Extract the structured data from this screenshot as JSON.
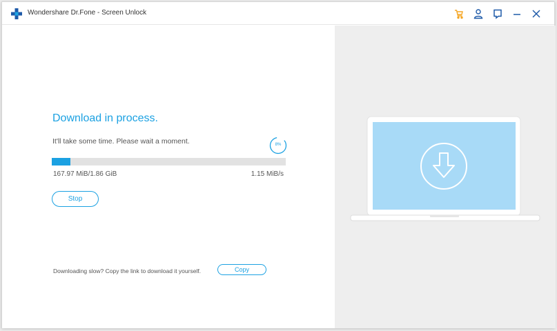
{
  "window": {
    "title": "Wondershare Dr.Fone - Screen Unlock",
    "icons": [
      "cart-icon",
      "account-icon",
      "feedback-icon",
      "minimize-icon",
      "close-icon"
    ]
  },
  "colors": {
    "accent": "#1ba1e2",
    "cart": "#f5a623",
    "right_panel_bg": "#eeeeee",
    "screen_bg": "#a8daf7"
  },
  "download": {
    "heading": "Download in process.",
    "subtext": "It'll take some time. Please wait a moment.",
    "percent_label": "8%",
    "progress": 0.08,
    "size": "167.97 MiB/1.86 GiB",
    "speed": "1.15 MiB/s",
    "stop_label": "Stop",
    "slow_text": "Downloading slow? Copy the link to download it yourself.",
    "copy_label": "Copy"
  }
}
